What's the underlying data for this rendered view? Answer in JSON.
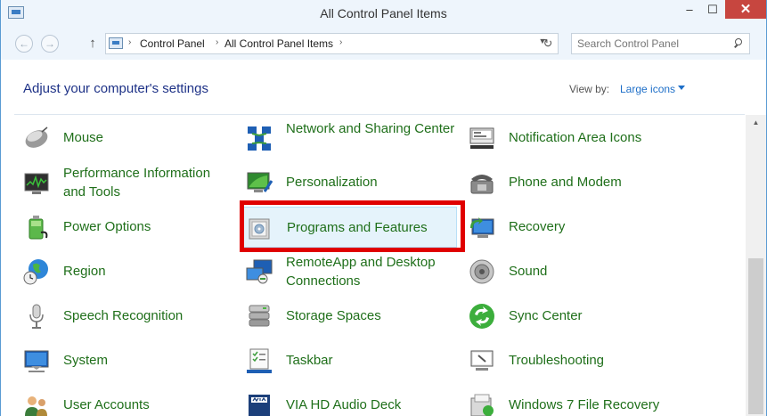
{
  "window": {
    "title": "All Control Panel Items",
    "minimize": "–",
    "maximize": "☐",
    "close": "✕"
  },
  "nav": {
    "back": "←",
    "forward": "→",
    "up": "↑",
    "breadcrumbs": [
      "Control Panel",
      "All Control Panel Items"
    ],
    "search_placeholder": "Search Control Panel"
  },
  "header": {
    "title": "Adjust your computer's settings",
    "view_by_label": "View by:",
    "view_by_value": "Large icons"
  },
  "items": [
    {
      "label": "Mouse",
      "icon": "mouse-icon"
    },
    {
      "label": "Network and Sharing Center",
      "icon": "network-icon"
    },
    {
      "label": "Notification Area Icons",
      "icon": "notification-icon"
    },
    {
      "label": "Performance Information and Tools",
      "icon": "performance-icon"
    },
    {
      "label": "Personalization",
      "icon": "personalization-icon"
    },
    {
      "label": "Phone and Modem",
      "icon": "phone-icon"
    },
    {
      "label": "Power Options",
      "icon": "power-icon"
    },
    {
      "label": "Programs and Features",
      "icon": "programs-icon",
      "selected": true
    },
    {
      "label": "Recovery",
      "icon": "recovery-icon"
    },
    {
      "label": "Region",
      "icon": "globe-icon"
    },
    {
      "label": "RemoteApp and Desktop Connections",
      "icon": "remoteapp-icon"
    },
    {
      "label": "Sound",
      "icon": "speaker-icon"
    },
    {
      "label": "Speech Recognition",
      "icon": "microphone-icon"
    },
    {
      "label": "Storage Spaces",
      "icon": "storage-icon"
    },
    {
      "label": "Sync Center",
      "icon": "sync-icon"
    },
    {
      "label": "System",
      "icon": "system-icon"
    },
    {
      "label": "Taskbar",
      "icon": "taskbar-icon"
    },
    {
      "label": "Troubleshooting",
      "icon": "troubleshooting-icon"
    },
    {
      "label": "User Accounts",
      "icon": "users-icon"
    },
    {
      "label": "VIA HD Audio Deck",
      "icon": "audio-deck-icon"
    },
    {
      "label": "Windows 7 File Recovery",
      "icon": "file-recovery-icon"
    }
  ],
  "colors": {
    "link_green": "#1f6f1a",
    "title_blue": "#1e3287",
    "highlight_red": "#e00000",
    "close_red": "#c7463f"
  }
}
